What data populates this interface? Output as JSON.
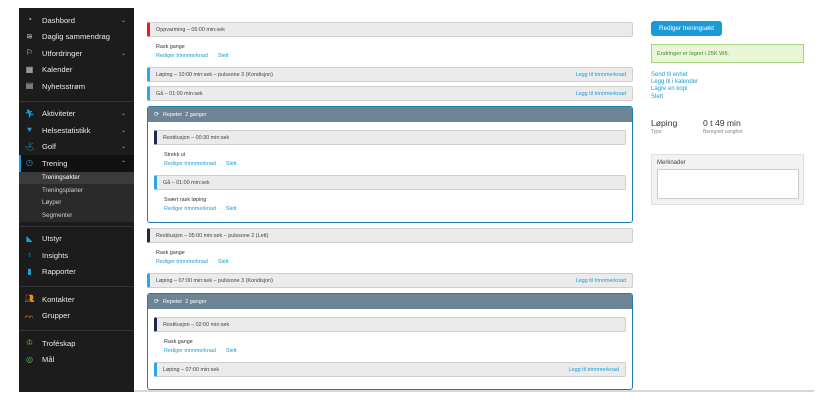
{
  "sidebar": {
    "group1": [
      {
        "label": "Dashbord",
        "icon": "dashboard-icon",
        "chevron": true
      },
      {
        "label": "Daglig sammendrag",
        "icon": "layers-icon",
        "chevron": false
      },
      {
        "label": "Utfordringer",
        "icon": "challenges-icon",
        "chevron": true
      },
      {
        "label": "Kalender",
        "icon": "calendar-icon",
        "chevron": false
      },
      {
        "label": "Nyhetsstrøm",
        "icon": "newsfeed-icon",
        "chevron": false
      }
    ],
    "group2": [
      {
        "label": "Aktiviteter",
        "icon": "activities-icon",
        "chevron": true
      },
      {
        "label": "Helsestatistikk",
        "icon": "heart-icon",
        "chevron": true
      },
      {
        "label": "Golf",
        "icon": "golf-icon",
        "chevron": true
      },
      {
        "label": "Trening",
        "icon": "stopwatch-icon",
        "chevron": true,
        "active": true
      }
    ],
    "sub": [
      "Treningsøkter",
      "Treningsplaner",
      "Løyper",
      "Segmenter"
    ],
    "group3": [
      {
        "label": "Utstyr",
        "icon": "shoe-icon"
      },
      {
        "label": "Insights",
        "icon": "bulb-icon"
      },
      {
        "label": "Rapporter",
        "icon": "reports-icon"
      }
    ],
    "group4": [
      {
        "label": "Kontakter",
        "icon": "contacts-icon"
      },
      {
        "label": "Grupper",
        "icon": "groups-icon"
      }
    ],
    "group5": [
      {
        "label": "Troféskap",
        "icon": "trophy-icon"
      },
      {
        "label": "Mål",
        "icon": "target-icon"
      }
    ]
  },
  "workout": {
    "step_warmup": "Oppvarming – 05:00 min:sek",
    "note_rask": "Rask gange",
    "link_edit": "Rediger trinnmerknad",
    "link_delete": "Slett",
    "step_run10": "Løping – 10:00 min:sek – pulssone 3 (Kondisjon)",
    "link_add_note": "Legg til trinnmerknad",
    "step_walk1": "Gå – 01:00 min:sek",
    "repeat1_label": "Repeter",
    "repeat1_count": "2 ganger",
    "step_rest30": "Restitusjon – 00:30 min:sek",
    "note_strekk": "Strekk ut",
    "step_walk1b": "Gå – 01:00 min:sek",
    "note_svaert": "Svært rask løping",
    "step_rest05": "Restitusjon – 05:00 min:sek – pulssone 2 (Lett)",
    "note_rask2": "Rask gange",
    "step_run07": "Løping – 07:00 min:sek – pulssone 3 (Kondisjon)",
    "repeat2_label": "Repeter",
    "repeat2_count": "2 ganger",
    "step_rest02": "Restitusjon – 02:00 min:sek",
    "note_rask3": "Rask gange",
    "step_run07b": "Løping – 07:00 min:sek"
  },
  "right": {
    "edit_button": "Rediger treningsøkt",
    "alert": "Endringer er lagret i 25K W6.",
    "send_link": "Send til enhet",
    "add_calendar_link": "Legg til i kalender",
    "save_copy_link": "Lagre en kopi",
    "delete_link": "Slett",
    "type_value": "Løping",
    "type_label": "Type",
    "duration_value": "0 t 49 min",
    "duration_label": "Beregnet varighet",
    "notes_title": "Merknader"
  },
  "colors": {
    "accent": "#1a9bd7",
    "warmup_bar": "#e21f26",
    "active_bar": "#2da7e1",
    "rest_bar": "#1c2a45",
    "repeat_header": "#6e8596"
  }
}
